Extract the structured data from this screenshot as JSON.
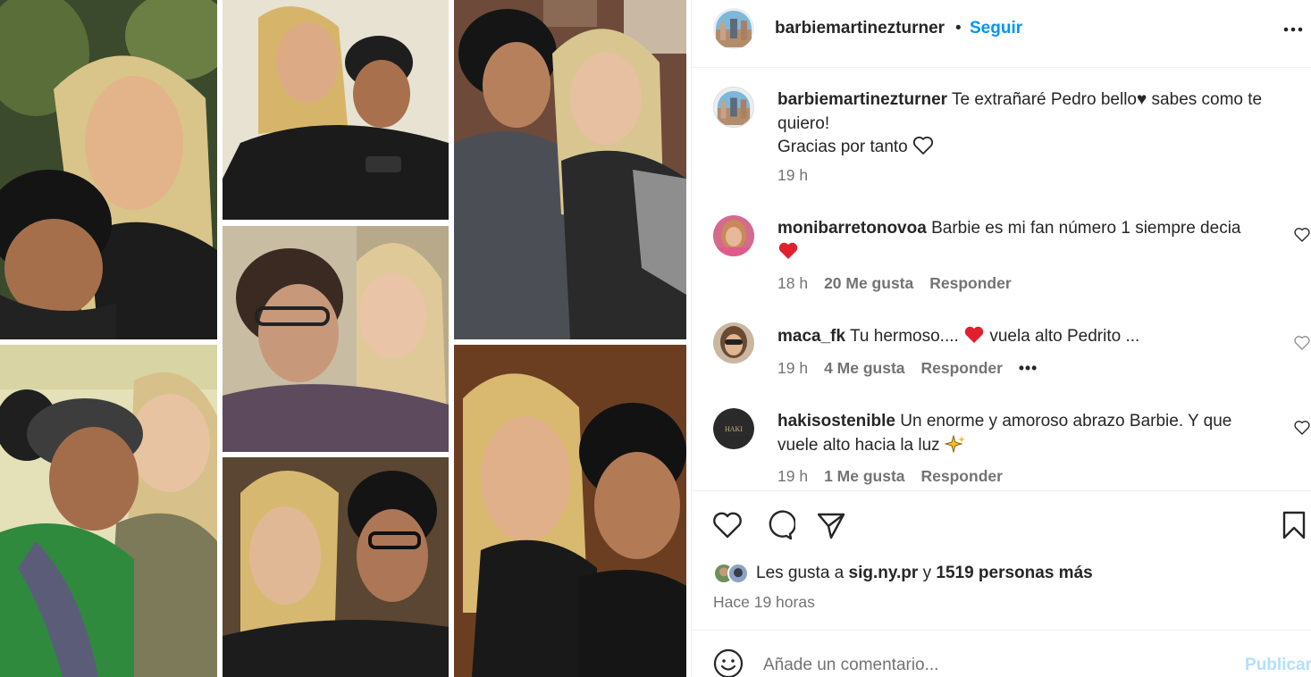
{
  "post": {
    "username": "barbiemartinezturner",
    "separator": "•",
    "follow_label": "Seguir"
  },
  "caption": {
    "username": "barbiemartinezturner",
    "line1": "Te extrañaré Pedro bello♥ sabes como te",
    "line2": "quiero!",
    "line3": "Gracias por tanto",
    "time": "19 h"
  },
  "comments": [
    {
      "username": "monibarretonovoa",
      "text": "Barbie es mi fan número 1 siempre decia",
      "time": "18 h",
      "likes": "20 Me gusta",
      "reply": "Responder"
    },
    {
      "username": "maca_fk",
      "text_before": "Tu hermoso....",
      "text_after": "vuela alto Pedrito ...",
      "time": "19 h",
      "likes": "4 Me gusta",
      "reply": "Responder",
      "more": "•••"
    },
    {
      "username": "hakisostenible",
      "text": "Un enorme y amoroso abrazo Barbie. Y que",
      "text2": "vuele alto hacia la luz",
      "time": "19 h",
      "likes": "1 Me gusta",
      "reply": "Responder"
    }
  ],
  "likes": {
    "prefix": "Les gusta a",
    "user": "sig.ny.pr",
    "joiner": "y",
    "others": "1519 personas más"
  },
  "timestamp": "Hace 19 horas",
  "composer": {
    "placeholder": "Añade un comentario...",
    "publish_label": "Publicar"
  },
  "icons": {
    "heart": "heart-icon",
    "comment": "comment-icon",
    "share": "paper-plane-icon",
    "save": "bookmark-icon",
    "emoji": "emoji-icon",
    "more": "more-horizontal-icon"
  },
  "colors": {
    "link_blue": "#0095f6",
    "publish_disabled": "#b2dffc",
    "muted": "#737373",
    "text": "#262626",
    "red_heart": "#ff3040"
  }
}
